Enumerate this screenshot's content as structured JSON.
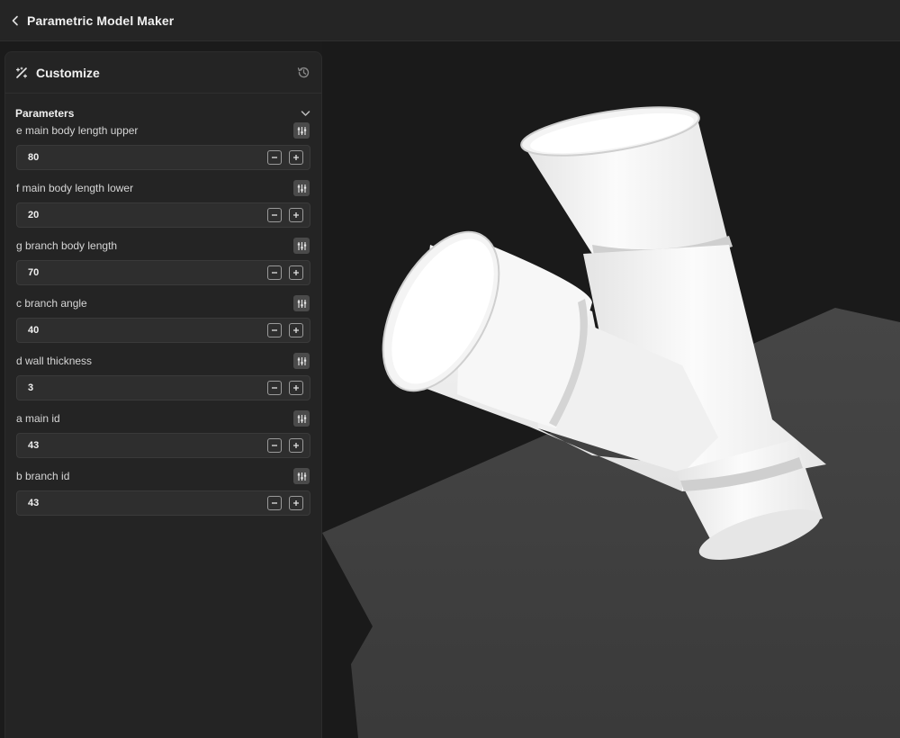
{
  "app": {
    "title": "Parametric Model Maker"
  },
  "panel": {
    "title": "Customize",
    "section_title": "Parameters",
    "parameters": [
      {
        "label": "e main body length upper",
        "value": "80"
      },
      {
        "label": "f main body length lower",
        "value": "20"
      },
      {
        "label": "g branch body length",
        "value": "70"
      },
      {
        "label": "c branch angle",
        "value": "40"
      },
      {
        "label": "d wall thickness",
        "value": "3"
      },
      {
        "label": "a main id",
        "value": "43"
      },
      {
        "label": "b branch id",
        "value": "43"
      }
    ]
  },
  "icons": {
    "back": "chevron-left-icon",
    "customize": "magic-wand-icon",
    "history": "history-icon",
    "collapse": "chevron-down-icon",
    "slider": "sliders-icon",
    "minus": "minus-icon",
    "plus": "plus-icon"
  },
  "colors": {
    "background": "#1b1b1b",
    "panel": "#242424",
    "field": "#2e2e2e",
    "model": "#f2f2f2",
    "ground_plane": "#3c3c3c"
  }
}
